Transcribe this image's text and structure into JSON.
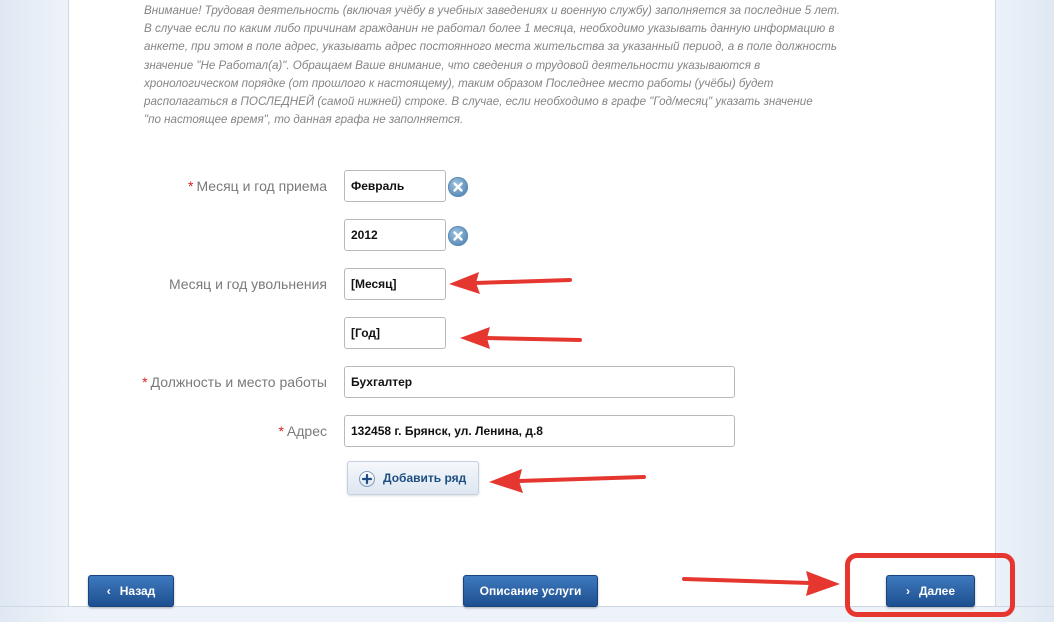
{
  "notice": {
    "lines": [
      "Внимание! Трудовая деятельность (включая учёбу в учебных заведениях и военную службу) заполняется за последние 5 лет.",
      "В случае если по каким либо причинам гражданин не работал более 1 месяца, необходимо указывать данную информацию в",
      "анкете, при этом в поле адрес, указывать адрес постоянного места жительства за указанный период, а в поле должность",
      "значение \"Не Работал(а)\". Обращаем Ваше внимание, что сведения о трудовой деятельности указываются в",
      "хронологическом порядке (от прошлого к настоящему), таким образом Последнее место работы (учёбы) будет",
      "располагаться в ПОСЛЕДНЕЙ (самой нижней) строке. В случае, если необходимо в графе \"Год/месяц\" указать значение",
      "\"по настоящее время\", то данная графа не заполняется."
    ]
  },
  "form": {
    "required_mark": "*",
    "hire_label": "Месяц и год приема",
    "hire_month": "Февраль",
    "hire_year": "2012",
    "dismissal_label": "Месяц и год увольнения",
    "dismissal_month": "[Месяц]",
    "dismissal_year": "[Год]",
    "position_label": "Должность и место работы",
    "position_value": "Бухгалтер",
    "address_label": "Адрес",
    "address_value": "132458 г. Брянск, ул. Ленина, д.8",
    "add_row_label": "Добавить ряд"
  },
  "footer": {
    "back_label": "Назад",
    "description_label": "Описание услуги",
    "next_label": "Далее"
  },
  "colors": {
    "annotation_red": "#e53730",
    "button_blue": "#1d4f8f",
    "required_red": "#d71f1f"
  }
}
